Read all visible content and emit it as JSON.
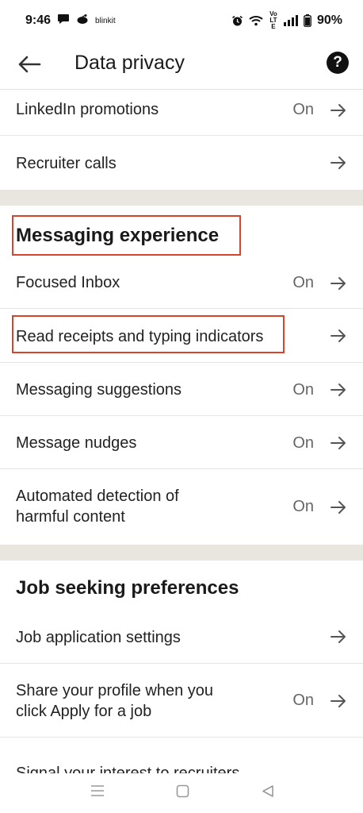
{
  "status_bar": {
    "time": "9:46",
    "mini_app": "blinkit",
    "volte": "Vo LTE",
    "battery": "90%"
  },
  "header": {
    "title": "Data privacy",
    "help_glyph": "?"
  },
  "rows_top": [
    {
      "label": "LinkedIn promotions",
      "value": "On"
    },
    {
      "label": "Recruiter calls",
      "value": ""
    }
  ],
  "messaging": {
    "title": "Messaging experience",
    "rows": [
      {
        "label": "Focused Inbox",
        "value": "On"
      },
      {
        "label": "Read receipts and typing indicators",
        "value": ""
      },
      {
        "label": "Messaging suggestions",
        "value": "On"
      },
      {
        "label": "Message nudges",
        "value": "On"
      },
      {
        "label_line1": "Automated detection of",
        "label_line2": "harmful content",
        "value": "On"
      }
    ]
  },
  "job_seeking": {
    "title": "Job seeking preferences",
    "rows": [
      {
        "label": "Job application settings",
        "value": ""
      },
      {
        "label_line1": "Share your profile when you",
        "label_line2": "click Apply for a job",
        "value": "On"
      },
      {
        "label": "Signal your interest to recruiters"
      }
    ]
  },
  "icons": {
    "back": "arrow-left-icon",
    "help": "help-circle-icon",
    "row_arrow": "arrow-right-icon",
    "nav_menu": "menu-icon",
    "nav_home": "home-square-icon",
    "nav_back": "back-triangle-icon"
  },
  "colors": {
    "highlight": "#d6442c",
    "divider": "#e9e5df"
  }
}
